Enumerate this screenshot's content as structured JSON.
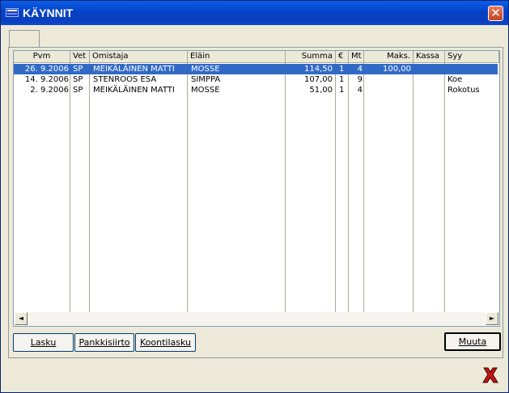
{
  "window": {
    "title": "KÄYNNIT"
  },
  "columns": [
    "Pvm",
    "Vet",
    "Omistaja",
    "Eläin",
    "Summa",
    "€",
    "Mt",
    "Maks.",
    "Kassa",
    "Syy"
  ],
  "rows": [
    {
      "pvm": "26. 9.2006",
      "vet": "SP",
      "omistaja": "MEIKÄLÄINEN MATTI",
      "elain": "MOSSE",
      "summa": "114,50",
      "eur": "1",
      "mt": "4",
      "maks": "100,00",
      "kassa": "",
      "syy": ""
    },
    {
      "pvm": "14. 9.2006",
      "vet": "SP",
      "omistaja": "STENROOS ESA",
      "elain": "SIMPPA",
      "summa": "107,00",
      "eur": "1",
      "mt": "9",
      "maks": "",
      "kassa": "",
      "syy": "Koe"
    },
    {
      "pvm": "2. 9.2006",
      "vet": "SP",
      "omistaja": "MEIKÄLÄINEN MATTI",
      "elain": "MOSSE",
      "summa": "51,00",
      "eur": "1",
      "mt": "4",
      "maks": "",
      "kassa": "",
      "syy": "Rokotus"
    }
  ],
  "scroll": {
    "left": "◄",
    "right": "►"
  },
  "buttons": {
    "lasku": "Lasku",
    "pankkisiirto": "Pankkisiirto",
    "koontilasku": "Koontilasku",
    "muuta": "Muuta"
  },
  "icons": {
    "close": "close-icon",
    "exit": "exit-icon"
  },
  "colors": {
    "titlebar": "#0a49d1",
    "selection": "#316ac5",
    "exit_red": "#c81414"
  }
}
